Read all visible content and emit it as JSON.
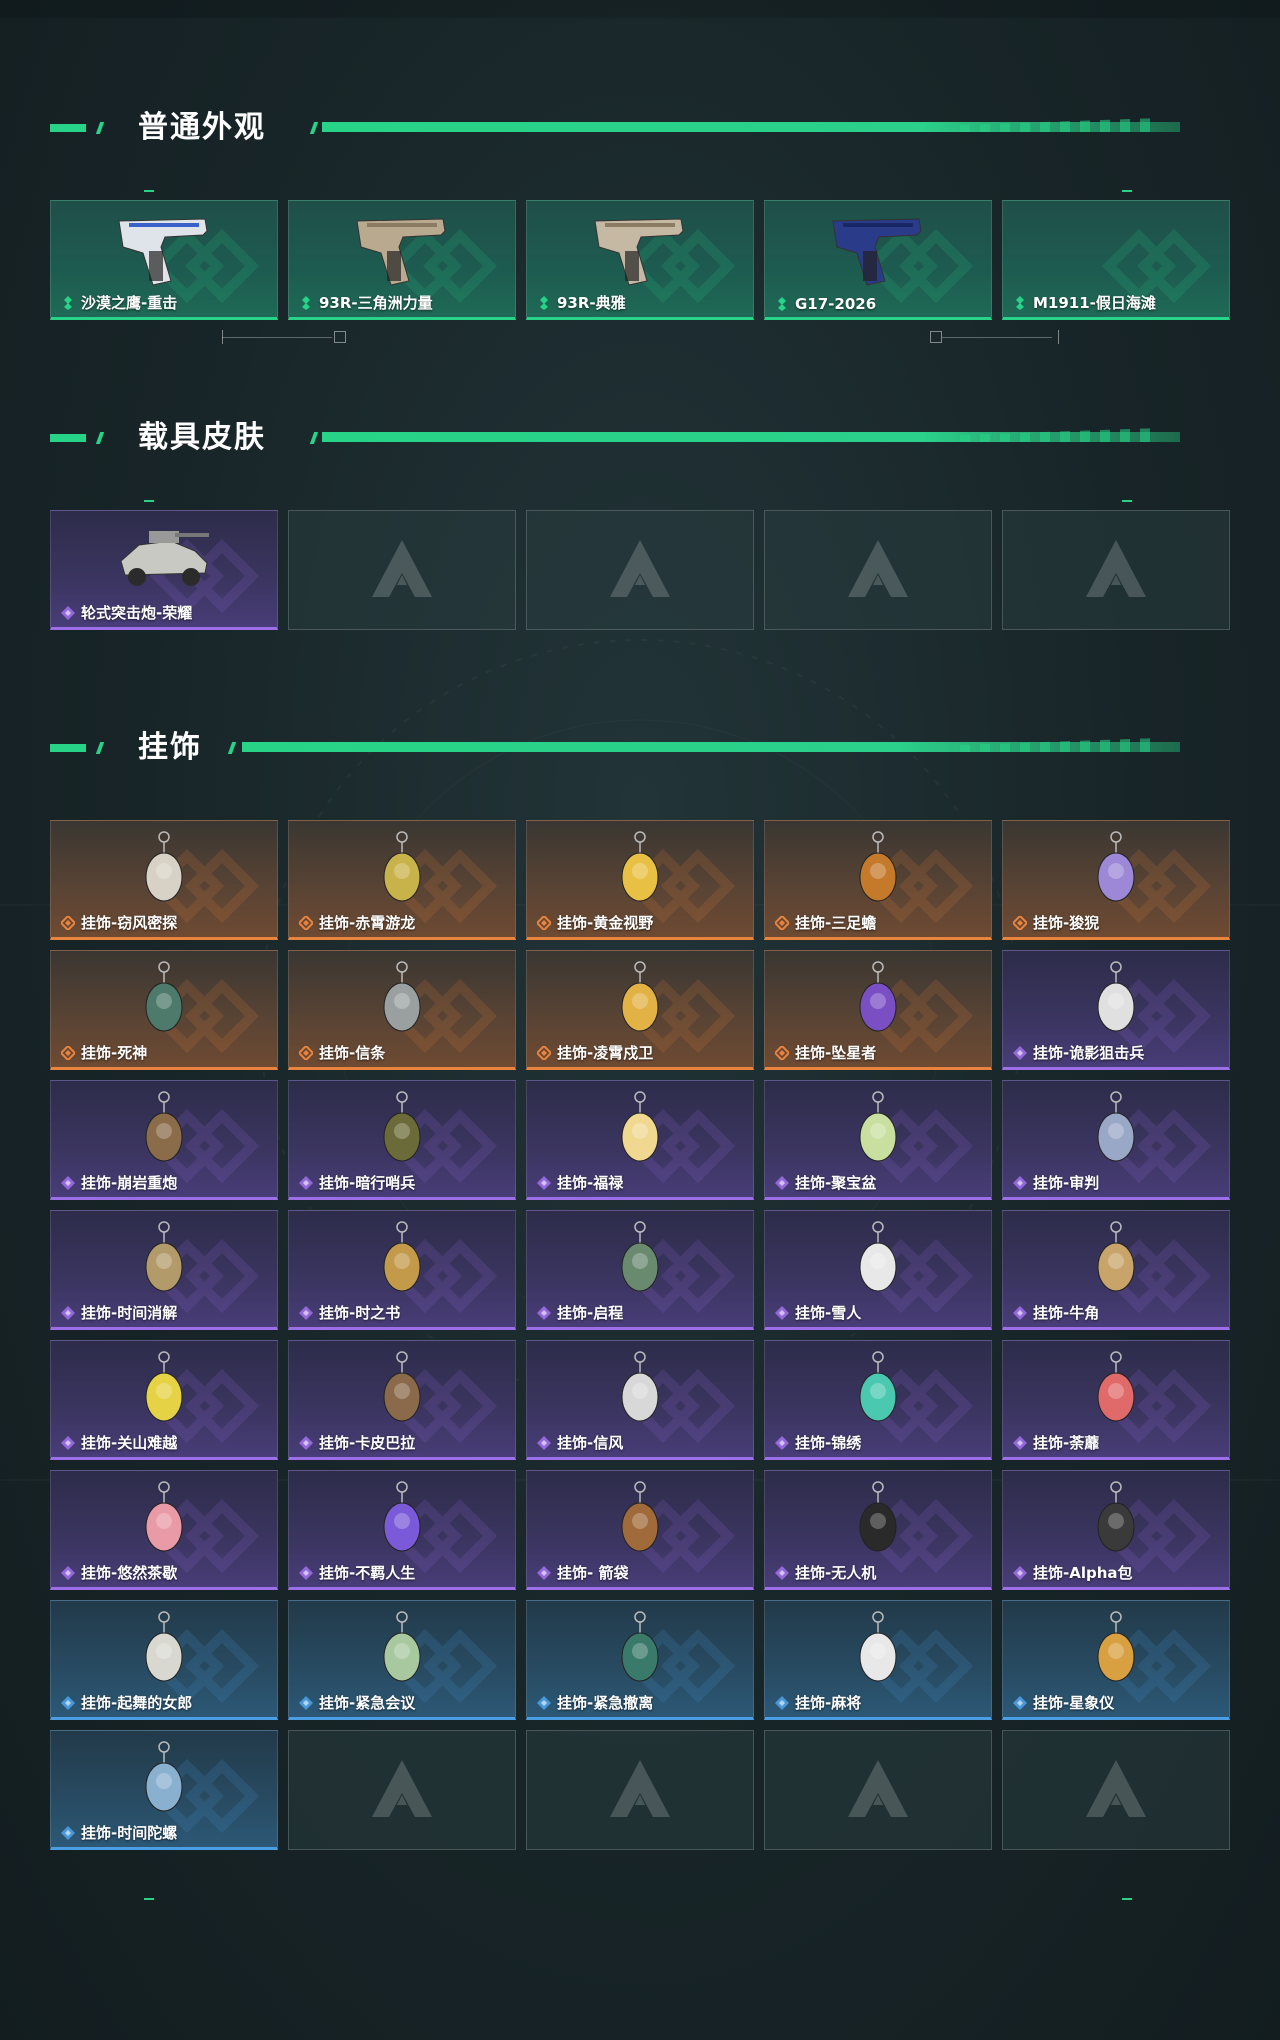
{
  "sections": {
    "weapon": {
      "title": "普通外观",
      "items": [
        {
          "label": "沙漠之鹰-重击",
          "rarity": "green",
          "icon": "pistol-white-blue-icon"
        },
        {
          "label": "93R-三角洲力量",
          "rarity": "green",
          "icon": "pistol-tan-icon"
        },
        {
          "label": "93R-典雅",
          "rarity": "green",
          "icon": "pistol-tan-icon"
        },
        {
          "label": "G17-2026",
          "rarity": "green",
          "icon": "pistol-navy-icon"
        },
        {
          "label": "M1911-假日海滩",
          "rarity": "green",
          "icon": "empty-icon"
        }
      ]
    },
    "vehicle": {
      "title": "载具皮肤",
      "items": [
        {
          "label": "轮式突击炮-荣耀",
          "rarity": "purple",
          "icon": "armored-vehicle-icon"
        }
      ]
    },
    "charm": {
      "title": "挂饰",
      "items": [
        {
          "label": "挂饰-窃风密探",
          "rarity": "orange"
        },
        {
          "label": "挂饰-赤霄游龙",
          "rarity": "orange"
        },
        {
          "label": "挂饰-黄金视野",
          "rarity": "orange"
        },
        {
          "label": "挂饰-三足蟾",
          "rarity": "orange"
        },
        {
          "label": "挂饰-狻猊",
          "rarity": "orange"
        },
        {
          "label": "挂饰-死神",
          "rarity": "orange"
        },
        {
          "label": "挂饰-信条",
          "rarity": "orange"
        },
        {
          "label": "挂饰-凌霄戍卫",
          "rarity": "orange"
        },
        {
          "label": "挂饰-坠星者",
          "rarity": "orange"
        },
        {
          "label": "挂饰-诡影狙击兵",
          "rarity": "purple"
        },
        {
          "label": "挂饰-崩岩重炮",
          "rarity": "purple"
        },
        {
          "label": "挂饰-暗行哨兵",
          "rarity": "purple"
        },
        {
          "label": "挂饰-福禄",
          "rarity": "purple"
        },
        {
          "label": "挂饰-聚宝盆",
          "rarity": "purple"
        },
        {
          "label": "挂饰-审判",
          "rarity": "purple"
        },
        {
          "label": "挂饰-时间消解",
          "rarity": "purple"
        },
        {
          "label": "挂饰-时之书",
          "rarity": "purple"
        },
        {
          "label": "挂饰-启程",
          "rarity": "purple"
        },
        {
          "label": "挂饰-雪人",
          "rarity": "purple"
        },
        {
          "label": "挂饰-牛角",
          "rarity": "purple"
        },
        {
          "label": "挂饰-关山难越",
          "rarity": "purple"
        },
        {
          "label": "挂饰-卡皮巴拉",
          "rarity": "purple"
        },
        {
          "label": "挂饰-信风",
          "rarity": "purple"
        },
        {
          "label": "挂饰-锦绣",
          "rarity": "purple"
        },
        {
          "label": "挂饰-荼蘼",
          "rarity": "purple"
        },
        {
          "label": "挂饰-悠然茶歇",
          "rarity": "purple"
        },
        {
          "label": "挂饰-不羁人生",
          "rarity": "purple"
        },
        {
          "label": "挂饰- 箭袋",
          "rarity": "purple"
        },
        {
          "label": "挂饰-无人机",
          "rarity": "purple"
        },
        {
          "label": "挂饰-Alpha包",
          "rarity": "purple"
        },
        {
          "label": "挂饰-起舞的女郎",
          "rarity": "blue"
        },
        {
          "label": "挂饰-紧急会议",
          "rarity": "blue"
        },
        {
          "label": "挂饰-紧急撤离",
          "rarity": "blue"
        },
        {
          "label": "挂饰-麻将",
          "rarity": "blue"
        },
        {
          "label": "挂饰-星象仪",
          "rarity": "blue"
        },
        {
          "label": "挂饰-时间陀螺",
          "rarity": "blue"
        }
      ]
    }
  },
  "colors": {
    "accent": "#27d487",
    "green": "#27d487",
    "purple": "#9c6ee8",
    "orange": "#e9843f",
    "blue": "#4b9ee3"
  }
}
